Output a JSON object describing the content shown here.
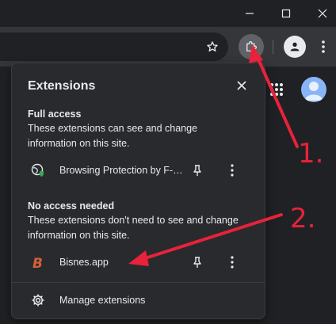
{
  "window": {
    "controls": [
      {
        "name": "minimize-icon"
      },
      {
        "name": "maximize-icon"
      },
      {
        "name": "close-icon"
      }
    ]
  },
  "toolbar": {
    "icons": [
      "star-icon",
      "puzzle-icon",
      "profile-icon",
      "more-vert-icon"
    ]
  },
  "page": {
    "icons": [
      "apps-grid-icon",
      "avatar-icon"
    ]
  },
  "extensions_panel": {
    "title": "Extensions",
    "full_access": {
      "title": "Full access",
      "description": "These extensions can see and change information on this site.",
      "items": [
        {
          "name": "Browsing Protection by F-Secure",
          "icon": "globe-shield-icon"
        }
      ]
    },
    "no_access": {
      "title": "No access needed",
      "description": "These extensions don't need to see and change information on this site.",
      "items": [
        {
          "name": "Bisnes.app",
          "icon": "bisnes-logo-icon"
        }
      ]
    },
    "manage_label": "Manage extensions"
  },
  "annotations": {
    "step1": "1.",
    "step2": "2.",
    "color": "#e8223a"
  },
  "colors": {
    "titlebar": "#202124",
    "toolbar": "#35363a",
    "panel": "#292a2d",
    "text": "#e8eaed",
    "accent": "#8ab4f8"
  }
}
